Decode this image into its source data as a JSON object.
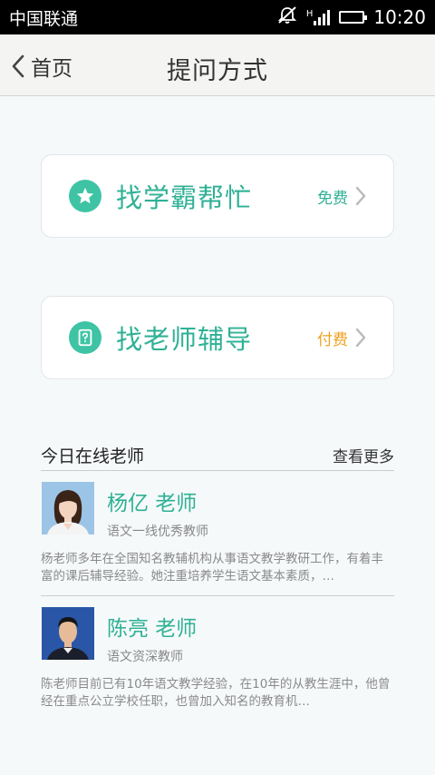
{
  "status_bar": {
    "carrier": "中国联通",
    "network": "H",
    "time": "10:20",
    "icons": [
      "mute-icon",
      "signal-icon",
      "battery-icon"
    ]
  },
  "header": {
    "back_label": "首页",
    "title": "提问方式"
  },
  "options": [
    {
      "title": "找学霸帮忙",
      "tag": "免费",
      "icon": "star-icon",
      "tag_color": "#2fb195"
    },
    {
      "title": "找老师辅导",
      "tag": "付费",
      "icon": "question-icon",
      "tag_color": "#f0a020"
    }
  ],
  "online": {
    "title": "今日在线老师",
    "more_label": "查看更多",
    "teachers": [
      {
        "name": "杨亿 老师",
        "role": "语文一线优秀教师",
        "bio": "杨老师多年在全国知名教辅机构从事语文教学教研工作，有着丰富的课后辅导经验。她注重培养学生语文基本素质，…"
      },
      {
        "name": "陈亮 老师",
        "role": "语文资深教师",
        "bio": "陈老师目前已有10年语文教学经验，在10年的从教生涯中，他曾经在重点公立学校任职，也曾加入知名的教育机…"
      }
    ]
  },
  "colors": {
    "accent": "#2fb195",
    "icon_bg": "#3ec4a4",
    "paid": "#f0a020"
  }
}
